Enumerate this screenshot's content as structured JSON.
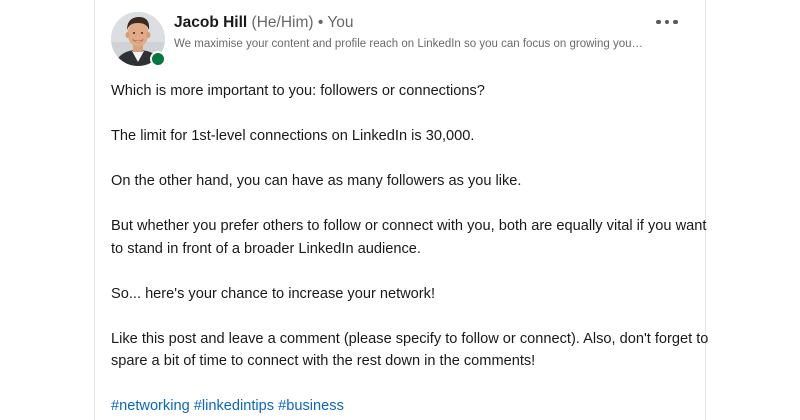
{
  "author": {
    "name": "Jacob Hill",
    "pronouns": "(He/Him)",
    "separator": "•",
    "relation": "You",
    "headline": "We maximise your content and profile reach on LinkedIn so you can focus on growing your business…",
    "online": true,
    "presence_color": "#057642"
  },
  "menu": {
    "icon": "more-horizontal-icon"
  },
  "post": {
    "paragraphs": [
      "Which is more important to you: followers or connections?",
      "The limit for 1st-level connections on LinkedIn is 30,000.",
      "On the other hand, you can have as many followers as you like.",
      "But whether you prefer others to follow or connect with you, both are equally vital if you want to stand in front of a broader LinkedIn audience.",
      "So... here's your chance to increase your network!",
      "Like this post and leave a comment (please specify to follow or connect). Also, don't forget to spare a bit of time to connect with the rest down in the comments!"
    ],
    "hashtags": [
      "#networking",
      "#linkedintips",
      "#business"
    ],
    "hashtag_color": "#0a66c2"
  }
}
